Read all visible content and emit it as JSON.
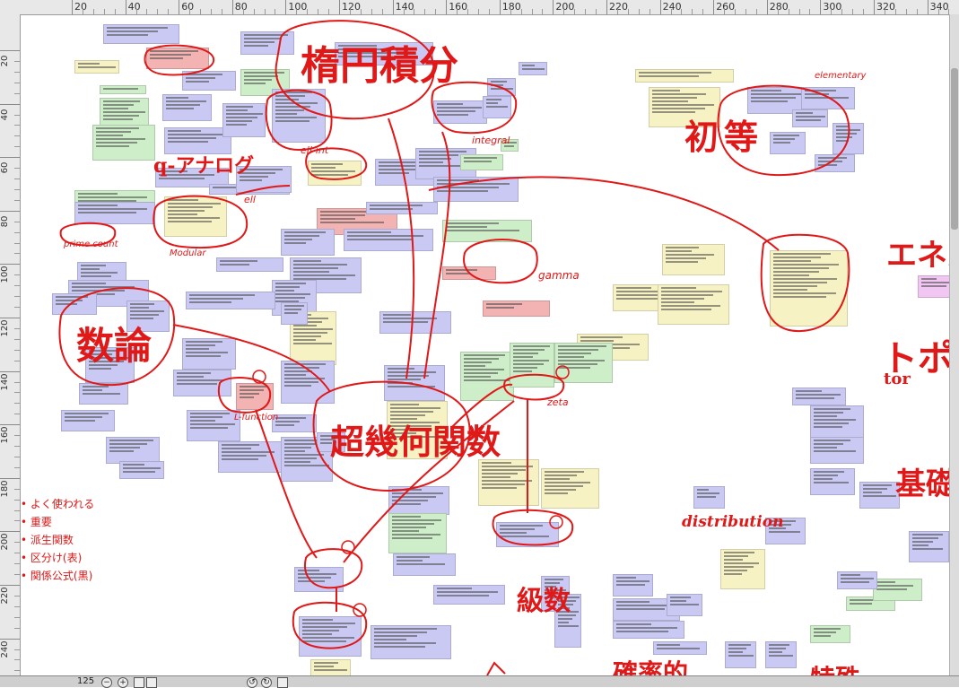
{
  "ruler": {
    "top_labels": [
      "20",
      "40",
      "60",
      "80",
      "100",
      "120",
      "140",
      "160",
      "180",
      "200",
      "220",
      "240",
      "260",
      "280",
      "300",
      "320",
      "340"
    ],
    "left_labels": [
      "20",
      "40",
      "60",
      "80",
      "100",
      "120",
      "140",
      "160",
      "180",
      "200",
      "220",
      "240"
    ]
  },
  "annotations": {
    "elliptic_integral": "楕円積分",
    "shoku": "初等",
    "elementary": "elementary",
    "integral": "integral",
    "ellint": "ell-int",
    "ell": "ell",
    "q_analog": "q-アナログ",
    "modular": "Modular",
    "gamma": "gamma",
    "prime_count": "prime count",
    "number_theory": "数論",
    "hypergeometric": "超幾何関数",
    "zeta": "zeta",
    "l_function": "L-function",
    "distribution": "distribution",
    "series": "級数",
    "basic": "基礎",
    "topology_partial": "トポ",
    "tor": "tor",
    "enko_partial": "エネル",
    "probability_partial": "確率的",
    "special_partial": "特殊",
    "N": "N"
  },
  "legend": {
    "items": [
      "よく使われる",
      "重要",
      "派生関数",
      "区分け(表)",
      "関係公式(黒)"
    ]
  },
  "statusbar": {
    "zoom": "125"
  },
  "colors": {
    "ink": "#e01818",
    "card_blue": "#c9c9f4",
    "card_green": "#cdeec8",
    "card_yellow": "#f7f2c4",
    "card_red": "#f3b3b3",
    "card_pink": "#f1c6f2"
  }
}
